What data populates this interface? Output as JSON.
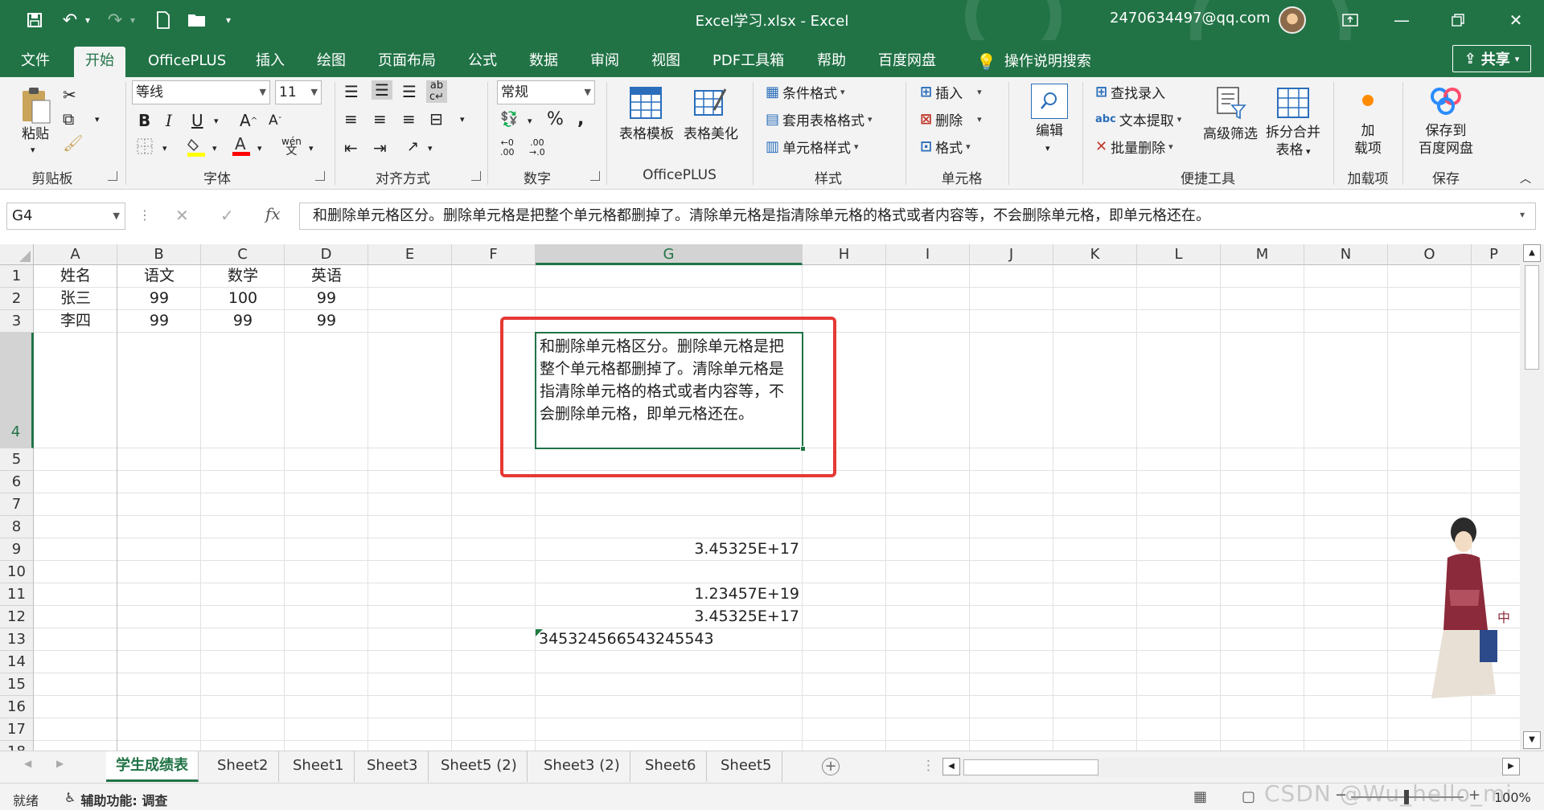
{
  "titlebar": {
    "title": "Excel学习.xlsx  -  Excel",
    "account": "2470634497@qq.com",
    "colors": {
      "brand": "#217346"
    }
  },
  "ribbon_tabs": [
    "文件",
    "开始",
    "OfficePLUS",
    "插入",
    "绘图",
    "页面布局",
    "公式",
    "数据",
    "审阅",
    "视图",
    "PDF工具箱",
    "帮助",
    "百度网盘"
  ],
  "tell_me": "操作说明搜索",
  "share_label": "共享",
  "ribbon": {
    "clipboard": {
      "paste": "粘贴",
      "label": "剪贴板"
    },
    "font": {
      "name": "等线",
      "size": "11",
      "label": "字体"
    },
    "alignment": {
      "label": "对齐方式"
    },
    "number": {
      "format": "常规",
      "label": "数字"
    },
    "officeplus": {
      "template": "表格模板",
      "beautify": "表格美化",
      "label": "OfficePLUS"
    },
    "styles": {
      "conditional": "条件格式",
      "table_format": "套用表格格式",
      "cell_style": "单元格样式",
      "label": "样式"
    },
    "cells": {
      "insert": "插入",
      "delete": "删除",
      "format": "格式",
      "label": "单元格"
    },
    "editing": {
      "label": "编辑"
    },
    "quick_tools": {
      "find_entry": "查找录入",
      "text_extract": "文本提取",
      "batch_delete": "批量删除",
      "advanced_filter": "高级筛选",
      "split_merge_1": "拆分合并",
      "split_merge_2": "表格",
      "label": "便捷工具"
    },
    "addins": {
      "line1": "加",
      "line2": "载项",
      "label": "加载项"
    },
    "save": {
      "line1": "保存到",
      "line2": "百度网盘",
      "label": "保存"
    }
  },
  "formula_bar": {
    "name_box": "G4",
    "content": "和删除单元格区分。删除单元格是把整个单元格都删掉了。清除单元格是指清除单元格的格式或者内容等，不会删除单元格，即单元格还在。"
  },
  "grid": {
    "columns": [
      "A",
      "B",
      "C",
      "D",
      "E",
      "F",
      "G",
      "H",
      "I",
      "J",
      "K",
      "L",
      "M",
      "N",
      "O",
      "P"
    ],
    "selected_column": "G",
    "rows": [
      "1",
      "2",
      "3",
      "4",
      "5",
      "6",
      "7",
      "8",
      "9",
      "10",
      "11",
      "12",
      "13",
      "14",
      "15",
      "16",
      "17",
      "18"
    ],
    "selected_row": "4",
    "table": [
      [
        "姓名",
        "语文",
        "数学",
        "英语"
      ],
      [
        "张三",
        "99",
        "100",
        "99"
      ],
      [
        "李四",
        "99",
        "99",
        "99"
      ]
    ],
    "g4_text": "和删除单元格区分。删除单元格是把整个单元格都删掉了。清除单元格是指清除单元格的格式或者内容等，不会删除单元格，即单元格还在。",
    "g9": "3.45325E+17",
    "g11": "1.23457E+19",
    "g12": "3.45325E+17",
    "g13": "345324566543245543"
  },
  "sheets": [
    "学生成绩表",
    "Sheet2",
    "Sheet1",
    "Sheet3",
    "Sheet5 (2)",
    "Sheet3 (2)",
    "Sheet6",
    "Sheet5"
  ],
  "active_sheet": "学生成绩表",
  "status": {
    "ready": "就绪",
    "accessibility": "辅助功能: 调查",
    "zoom": "100%",
    "watermark": "CSDN @Wu_hello_mi"
  }
}
